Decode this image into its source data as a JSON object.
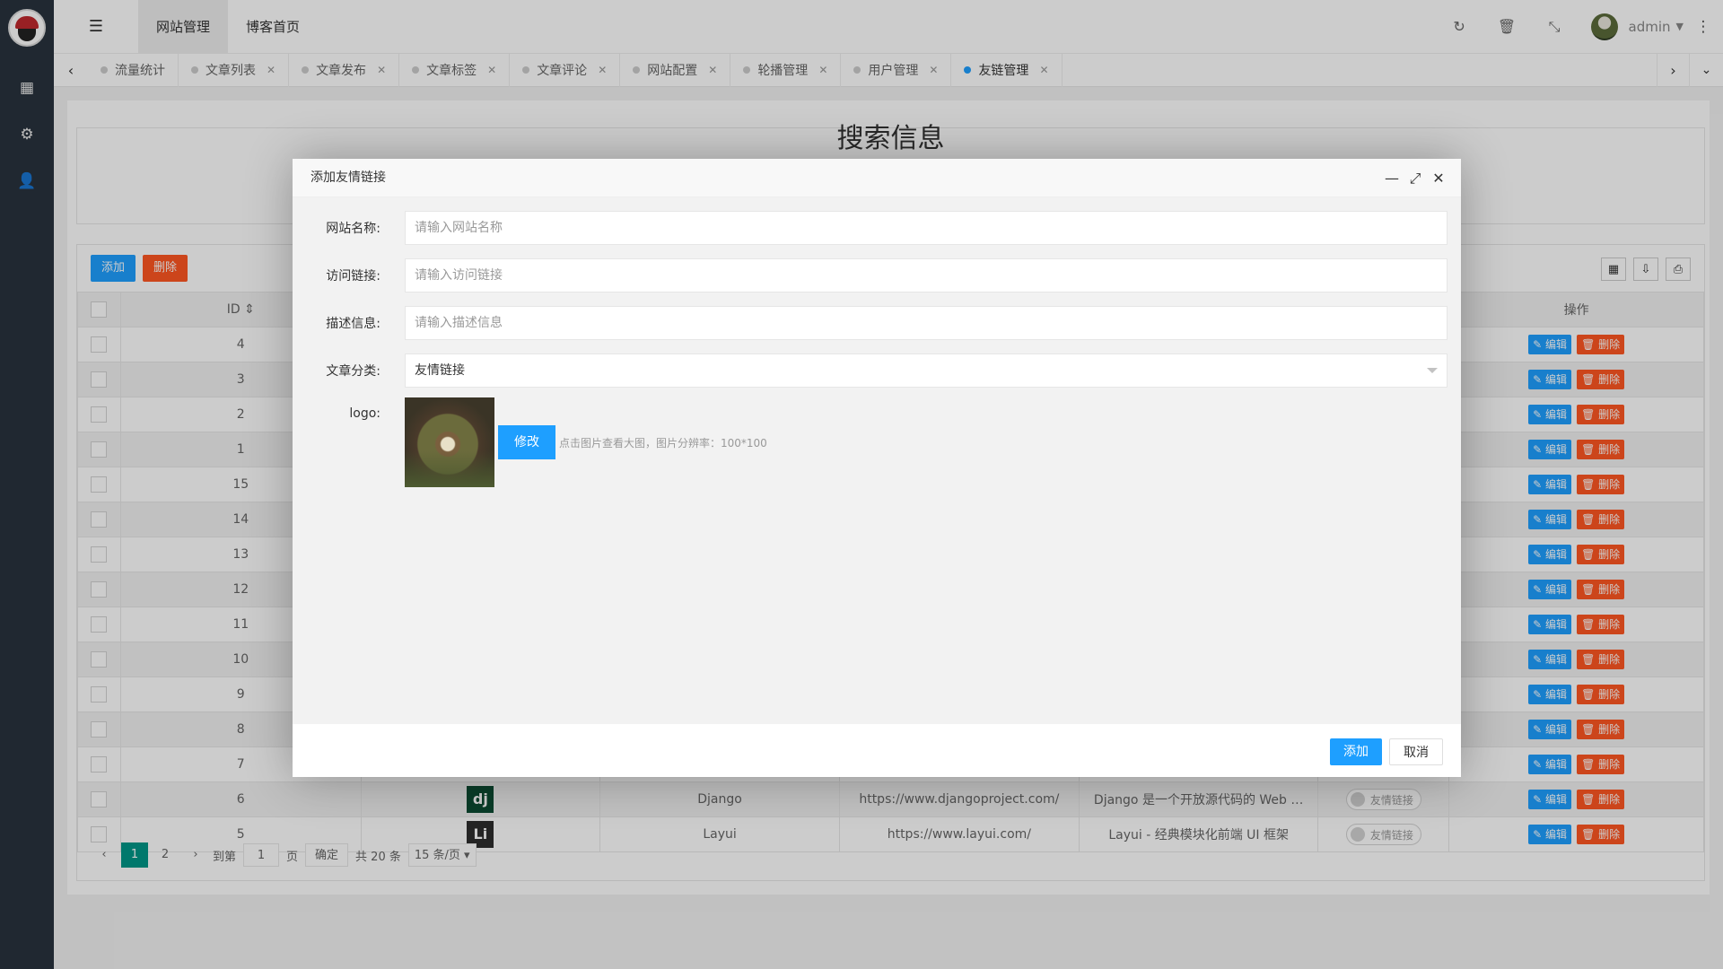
{
  "topbar": {
    "menu_tabs": [
      "网站管理",
      "博客首页"
    ],
    "username": "admin"
  },
  "tabs": [
    {
      "label": "流量统计",
      "closable": false
    },
    {
      "label": "文章列表",
      "closable": true
    },
    {
      "label": "文章发布",
      "closable": true
    },
    {
      "label": "文章标签",
      "closable": true
    },
    {
      "label": "文章评论",
      "closable": true
    },
    {
      "label": "网站配置",
      "closable": true
    },
    {
      "label": "轮播管理",
      "closable": true
    },
    {
      "label": "用户管理",
      "closable": true
    },
    {
      "label": "友链管理",
      "closable": true,
      "active": true
    }
  ],
  "search": {
    "title": "搜索信息"
  },
  "toolbar": {
    "add_label": "添加",
    "delete_label": "删除"
  },
  "table": {
    "headers": {
      "id": "ID",
      "actions": "操作"
    },
    "edit_label": "编辑",
    "delete_label": "删除",
    "ids": [
      "4",
      "3",
      "2",
      "1",
      "15",
      "14",
      "13",
      "12",
      "11",
      "10",
      "9",
      "8",
      "7"
    ],
    "rows_full": [
      {
        "id": "6",
        "logo": "dj",
        "name": "Django",
        "url": "https://www.djangoproject.com/",
        "desc": "Django 是一个开放源代码的 Web …",
        "status": "友情链接"
      },
      {
        "id": "5",
        "logo": "Li",
        "name": "Layui",
        "url": "https://www.layui.com/",
        "desc": "Layui - 经典模块化前端 UI 框架",
        "status": "友情链接"
      }
    ]
  },
  "pager": {
    "pages": [
      "1",
      "2"
    ],
    "goto_label": "到第",
    "page_label": "页",
    "current_input": "1",
    "confirm_label": "确定",
    "total_label": "共 20 条",
    "page_size": "15 条/页"
  },
  "modal": {
    "title": "添加友情链接",
    "fields": {
      "name_label": "网站名称:",
      "name_placeholder": "请输入网站名称",
      "url_label": "访问链接:",
      "url_placeholder": "请输入访问链接",
      "desc_label": "描述信息:",
      "desc_placeholder": "请输入描述信息",
      "category_label": "文章分类:",
      "category_value": "友情链接",
      "logo_label": "logo:"
    },
    "edit_button": "修改",
    "tip": "点击图片查看大图，图片分辨率：100*100",
    "submit": "添加",
    "cancel": "取消"
  },
  "colors": {
    "primary": "#1e9fff",
    "danger": "#ff5722",
    "pager_active": "#009688",
    "sidebar": "#28333e"
  }
}
